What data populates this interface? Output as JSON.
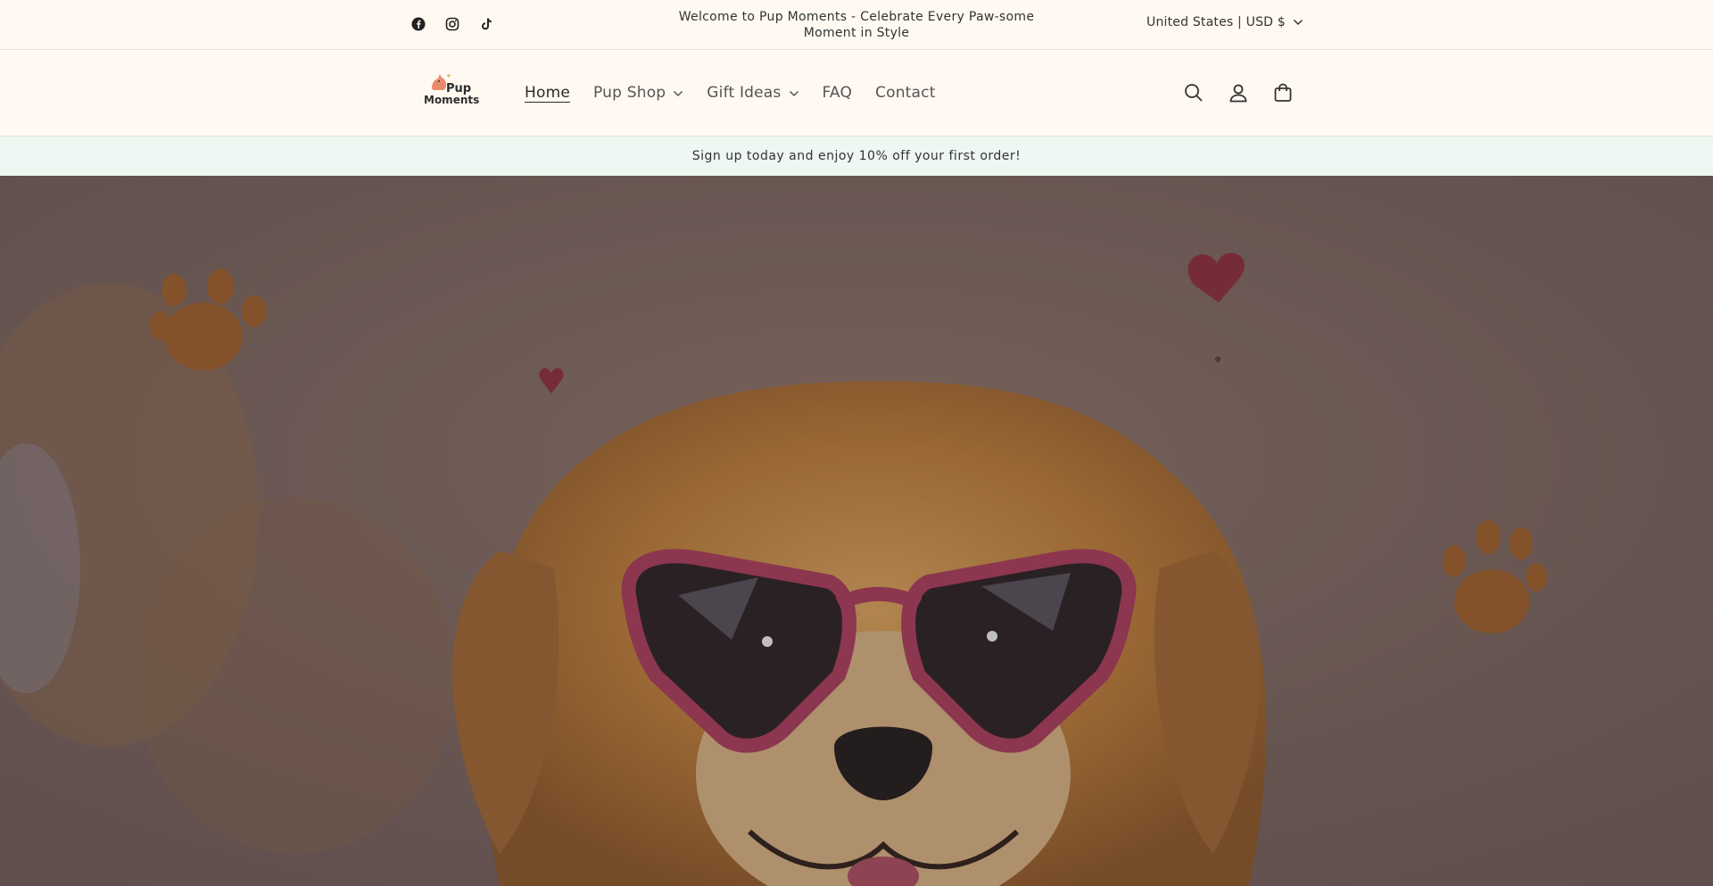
{
  "topbar": {
    "social": [
      {
        "name": "facebook-icon"
      },
      {
        "name": "instagram-icon"
      },
      {
        "name": "tiktok-icon"
      }
    ],
    "announcement": "Welcome to Pup Moments - Celebrate Every Paw-some Moment in Style",
    "locale": "United States | USD $"
  },
  "header": {
    "logo": {
      "line1": "Pup",
      "line2": "Moments"
    },
    "nav": [
      {
        "label": "Home",
        "active": true,
        "dropdown": false
      },
      {
        "label": "Pup Shop",
        "active": false,
        "dropdown": true
      },
      {
        "label": "Gift Ideas",
        "active": false,
        "dropdown": true
      },
      {
        "label": "FAQ",
        "active": false,
        "dropdown": false
      },
      {
        "label": "Contact",
        "active": false,
        "dropdown": false
      }
    ],
    "icons": [
      "search-icon",
      "account-icon",
      "cart-icon"
    ]
  },
  "promo": {
    "text": "Sign up today and enjoy 10% off your first order!"
  },
  "colors": {
    "background": "#fff9f1",
    "promo_bg": "#eef7f1",
    "hero_overlay": "#5b4a4a",
    "accent_pink": "#c2456a"
  }
}
